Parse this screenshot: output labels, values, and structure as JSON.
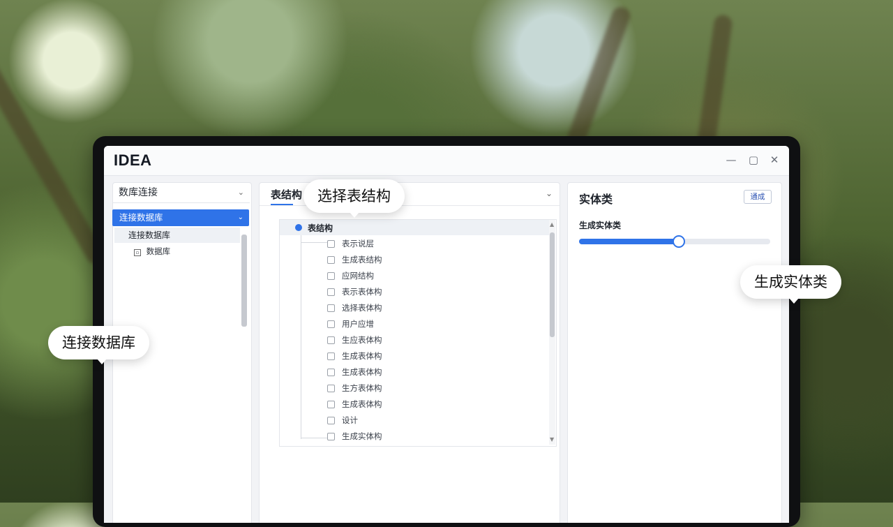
{
  "app": {
    "title": "IDEA"
  },
  "window_controls": [
    "—",
    "▢",
    "✕"
  ],
  "left_panel": {
    "select_value": "数库连接",
    "tree_header": "连接数据库",
    "tree_sub": "连接数据库",
    "tree_leaf": "数据库"
  },
  "middle_panel": {
    "tab_label": "表结构",
    "root_label": "表结构",
    "fields": [
      "表示说层",
      "生成表结构",
      "应网结构",
      "表示表体构",
      "选择表体构",
      "用户应增",
      "生应表体构",
      "生成表体构",
      "生成表体构",
      "生方表体构",
      "生成表体构",
      "设计",
      "生成实体构"
    ]
  },
  "right_panel": {
    "title": "实体类",
    "button_label": "通成",
    "slider_label": "生成实体类",
    "slider_value": 0.52
  },
  "callouts": {
    "select_table": "选择表结构",
    "generate_entity": "生成实体类",
    "connect_db": "连接数据库"
  }
}
